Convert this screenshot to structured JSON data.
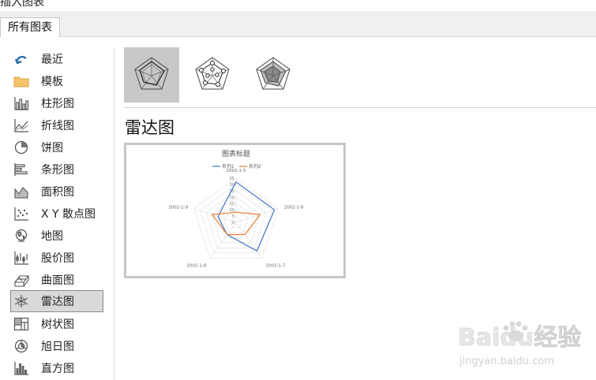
{
  "tabs": [
    {
      "label": "所有图表"
    }
  ],
  "sidebar": {
    "items": [
      {
        "label": "最近",
        "icon": "recent-arrow-icon"
      },
      {
        "label": "模板",
        "icon": "folder-icon"
      },
      {
        "label": "柱形图",
        "icon": "column-chart-icon"
      },
      {
        "label": "折线图",
        "icon": "line-chart-icon"
      },
      {
        "label": "饼图",
        "icon": "pie-chart-icon"
      },
      {
        "label": "条形图",
        "icon": "bar-chart-icon"
      },
      {
        "label": "面积图",
        "icon": "area-chart-icon"
      },
      {
        "label": "X Y 散点图",
        "icon": "scatter-chart-icon"
      },
      {
        "label": "地图",
        "icon": "map-chart-icon"
      },
      {
        "label": "股价图",
        "icon": "stock-chart-icon"
      },
      {
        "label": "曲面图",
        "icon": "surface-chart-icon"
      },
      {
        "label": "雷达图",
        "icon": "radar-chart-icon",
        "selected": true
      },
      {
        "label": "树状图",
        "icon": "treemap-chart-icon"
      },
      {
        "label": "旭日图",
        "icon": "sunburst-chart-icon"
      },
      {
        "label": "直方图",
        "icon": "histogram-chart-icon"
      }
    ]
  },
  "subtypes": [
    {
      "icon": "radar-basic-icon",
      "selected": true
    },
    {
      "icon": "radar-markers-icon",
      "selected": false
    },
    {
      "icon": "radar-filled-icon",
      "selected": false
    }
  ],
  "main": {
    "heading": "雷达图"
  },
  "chart_data": {
    "type": "radar",
    "title": "图表标题",
    "categories": [
      "2002-1-5",
      "2002-1-6",
      "2002-1-7",
      "2002-1-8",
      "2002-1-9"
    ],
    "series": [
      {
        "name": "系列1",
        "values": [
          32,
          32,
          28,
          12,
          15
        ],
        "color": "#4472c4"
      },
      {
        "name": "系列2",
        "values": [
          8,
          20,
          12,
          12,
          20
        ],
        "color": "#ed7d31"
      }
    ],
    "radial_ticks": [
      "0",
      "5",
      "10",
      "15",
      "20",
      "25",
      "30",
      "35"
    ],
    "rmax": 35,
    "legend_position": "top"
  },
  "watermark": {
    "brand": "Baidu经验",
    "url": "jingyan.baidu.com"
  }
}
